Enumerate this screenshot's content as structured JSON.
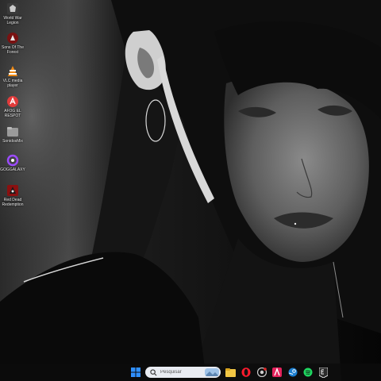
{
  "desktop": {
    "icons": [
      {
        "label": "World War Legion",
        "icon": "world-war-legion-icon"
      },
      {
        "label": "Sons Of The Forest",
        "icon": "sons-of-the-forest-icon"
      },
      {
        "label": "VLC media player",
        "icon": "vlc-icon"
      },
      {
        "label": "AFOG EL RESPOT",
        "icon": "app-icon"
      },
      {
        "label": "SonidosMix",
        "icon": "folder-icon"
      },
      {
        "label": "GOGGALAXY",
        "icon": "gog-galaxy-icon"
      },
      {
        "label": "Red Dead Redemption",
        "icon": "red-dead-redemption-icon"
      }
    ]
  },
  "taskbar": {
    "search_placeholder": "Pesquisar",
    "apps": [
      {
        "name": "start",
        "icon": "windows-start-icon",
        "color": "#2f8fff"
      },
      {
        "name": "file-explorer",
        "icon": "folder-icon",
        "color": "#f2c744"
      },
      {
        "name": "opera",
        "icon": "opera-icon",
        "color": "#ff1b2d"
      },
      {
        "name": "chrome",
        "icon": "chrome-icon",
        "color": "#cfcfcf"
      },
      {
        "name": "adobe",
        "icon": "adobe-icon",
        "color": "#e3225c"
      },
      {
        "name": "steam",
        "icon": "steam-icon",
        "color": "#1b7fd1"
      },
      {
        "name": "spotify",
        "icon": "spotify-icon",
        "color": "#1ed760"
      },
      {
        "name": "epic-games",
        "icon": "epic-games-icon",
        "color": "#ffffff"
      }
    ]
  }
}
